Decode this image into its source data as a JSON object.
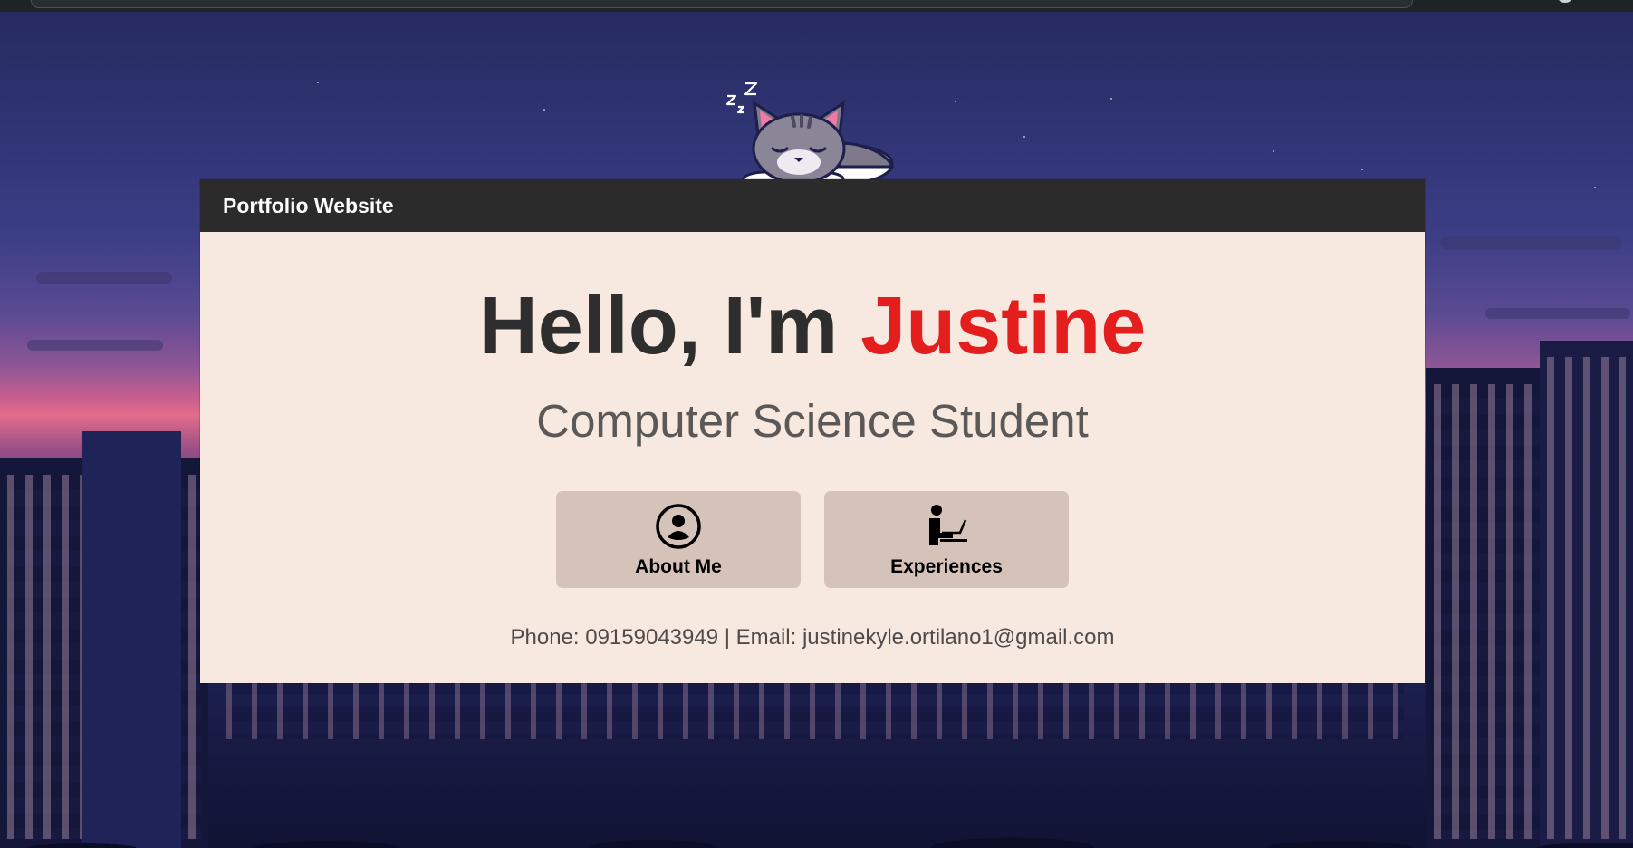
{
  "header": {
    "title": "Portfolio Website"
  },
  "hero": {
    "greeting": "Hello, I'm",
    "name": "Justine",
    "subtitle": "Computer Science Student"
  },
  "buttons": [
    {
      "label": "About Me",
      "icon": "user-circle-icon"
    },
    {
      "label": "Experiences",
      "icon": "person-laptop-icon"
    }
  ],
  "contact": {
    "text": "Phone: 09159043949 | Email: justinekyle.ortilano1@gmail.com"
  },
  "decoration": {
    "mascot": "sleeping-cat-icon",
    "sleep_text": "zZz"
  },
  "colors": {
    "header_bg": "#2b2b2b",
    "card_bg": "#f8e9e0",
    "accent_name": "#e41d1d",
    "button_bg": "#d5c2b8"
  }
}
